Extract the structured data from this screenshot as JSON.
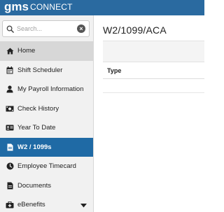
{
  "header": {
    "logo_g": "gms",
    "logo_text": "CONNECT",
    "brand_color": "#2a6aa0",
    "accent_dot_color": "#f2a33a"
  },
  "search": {
    "placeholder": "Search...",
    "icon": "search-icon",
    "clear_icon": "close-circle-icon"
  },
  "sidebar": {
    "items": [
      {
        "label": "Home",
        "icon": "home-icon",
        "state": "hover"
      },
      {
        "label": "Shift Scheduler",
        "icon": "calendar-icon"
      },
      {
        "label": "My Payroll Information",
        "icon": "user-icon"
      },
      {
        "label": "Check History",
        "icon": "money-icon"
      },
      {
        "label": "Year To Date",
        "icon": "id-card-icon"
      },
      {
        "label": "W2 / 1099s",
        "icon": "document-icon",
        "state": "active"
      },
      {
        "label": "Employee Timecard",
        "icon": "clock-icon"
      },
      {
        "label": "Documents",
        "icon": "file-icon"
      },
      {
        "label": "eBenefits",
        "icon": "medkit-icon",
        "has_submenu": true
      }
    ],
    "active_color": "#1f6aa5"
  },
  "main": {
    "title": "W2/1099/ACA",
    "table": {
      "columns": [
        "Type"
      ],
      "rows": []
    }
  }
}
